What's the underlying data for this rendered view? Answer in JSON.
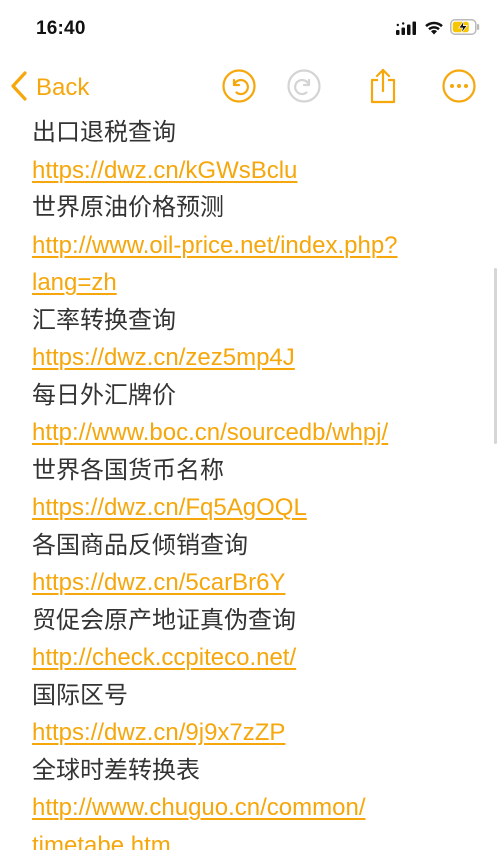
{
  "status_bar": {
    "time": "16:40"
  },
  "toolbar": {
    "back_label": "Back",
    "icons": [
      "chevron-left-icon",
      "undo-icon",
      "redo-icon",
      "share-icon",
      "more-icon"
    ],
    "accent_color": "#f5a70c",
    "disabled_color": "#d4d4d4"
  },
  "note": {
    "lines": [
      {
        "kind": "text",
        "value": "出口退税查询"
      },
      {
        "kind": "link",
        "value": "https://dwz.cn/kGWsBclu"
      },
      {
        "kind": "text",
        "value": "世界原油价格预测"
      },
      {
        "kind": "link",
        "value": "http://www.oil-price.net/index.php?"
      },
      {
        "kind": "link",
        "value": "lang=zh"
      },
      {
        "kind": "text",
        "value": "汇率转换查询"
      },
      {
        "kind": "link",
        "value": "https://dwz.cn/zez5mp4J"
      },
      {
        "kind": "text",
        "value": "每日外汇牌价"
      },
      {
        "kind": "link",
        "value": "http://www.boc.cn/sourcedb/whpj/"
      },
      {
        "kind": "text",
        "value": "世界各国货币名称"
      },
      {
        "kind": "link",
        "value": "https://dwz.cn/Fq5AgOQL"
      },
      {
        "kind": "text",
        "value": "各国商品反倾销查询"
      },
      {
        "kind": "link",
        "value": "https://dwz.cn/5carBr6Y"
      },
      {
        "kind": "text",
        "value": "贸促会原产地证真伪查询"
      },
      {
        "kind": "link",
        "value": "http://check.ccpiteco.net/"
      },
      {
        "kind": "text",
        "value": "国际区号"
      },
      {
        "kind": "link",
        "value": "https://dwz.cn/9j9x7zZP"
      },
      {
        "kind": "text",
        "value": "全球时差转换表"
      },
      {
        "kind": "link",
        "value": "http://www.chuguo.cn/common/"
      },
      {
        "kind": "link",
        "value": "timetabe.htm"
      }
    ]
  }
}
